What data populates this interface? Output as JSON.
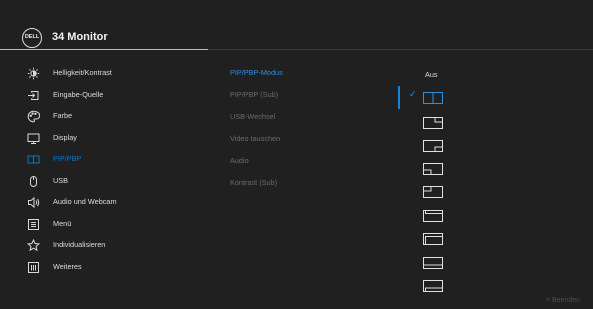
{
  "header": {
    "logo_text": "DELL",
    "title": "34 Monitor"
  },
  "menu": {
    "items": [
      {
        "label": "Helligkeit/Kontrast",
        "icon": "brightness-icon"
      },
      {
        "label": "Eingabe-Quelle",
        "icon": "input-source-icon"
      },
      {
        "label": "Farbe",
        "icon": "color-palette-icon"
      },
      {
        "label": "Display",
        "icon": "display-icon"
      },
      {
        "label": "PIP/PBP",
        "icon": "pip-pbp-icon",
        "active": true
      },
      {
        "label": "USB",
        "icon": "usb-mouse-icon"
      },
      {
        "label": "Audio und Webcam",
        "icon": "speaker-icon"
      },
      {
        "label": "Menü",
        "icon": "menu-list-icon"
      },
      {
        "label": "Individualisieren",
        "icon": "star-icon"
      },
      {
        "label": "Weiteres",
        "icon": "info-icon"
      }
    ]
  },
  "submenu": {
    "items": [
      {
        "label": "PIP/PBP-Modus",
        "active": true
      },
      {
        "label": "PIP/PBP (Sub)"
      },
      {
        "label": "USB-Wechsel"
      },
      {
        "label": "Video tauschen"
      },
      {
        "label": "Audio"
      },
      {
        "label": "Kontrast (Sub)"
      }
    ]
  },
  "options": {
    "off_label": "Aus",
    "selected_check": "✓",
    "layouts": [
      {
        "name": "pbp-side-by-side",
        "selected": true
      },
      {
        "name": "pip-top-right"
      },
      {
        "name": "pip-bottom-right"
      },
      {
        "name": "pip-bottom-left"
      },
      {
        "name": "pip-top-left"
      },
      {
        "name": "pbp-top-bottom-large"
      },
      {
        "name": "pbp-top-bottom-small"
      },
      {
        "name": "pbp-bottom-strip"
      },
      {
        "name": "pbp-bottom-strip-alt"
      }
    ]
  },
  "footer": {
    "exit_label": "<   Beenden"
  },
  "colors": {
    "background": "#202020",
    "accent": "#0a79c9",
    "text": "#dcdcdc",
    "inactive_text": "#6b6b6b"
  }
}
